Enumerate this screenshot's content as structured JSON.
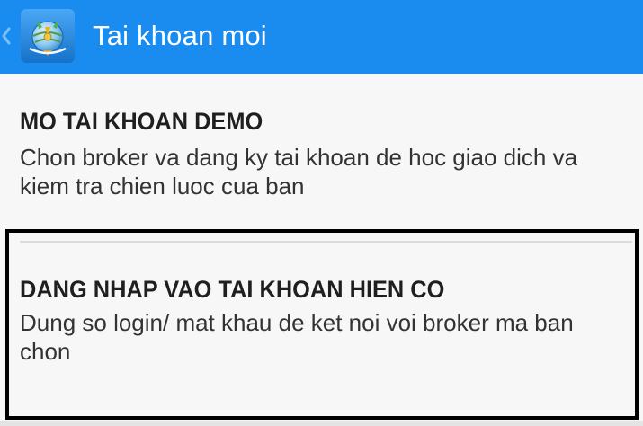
{
  "header": {
    "back_icon": "chevron-left-icon",
    "logo_icon": "metatrader-logo-icon",
    "title": "Tai khoan moi",
    "color": "#1a8cf0"
  },
  "options": [
    {
      "title": "MO TAI KHOAN DEMO",
      "description": "Chon broker va dang ky tai khoan de hoc giao dich va kiem tra chien luoc cua ban"
    },
    {
      "title": "DANG NHAP VAO TAI KHOAN HIEN CO",
      "description": "Dung so login/ mat khau de ket noi voi broker ma ban chon"
    }
  ]
}
